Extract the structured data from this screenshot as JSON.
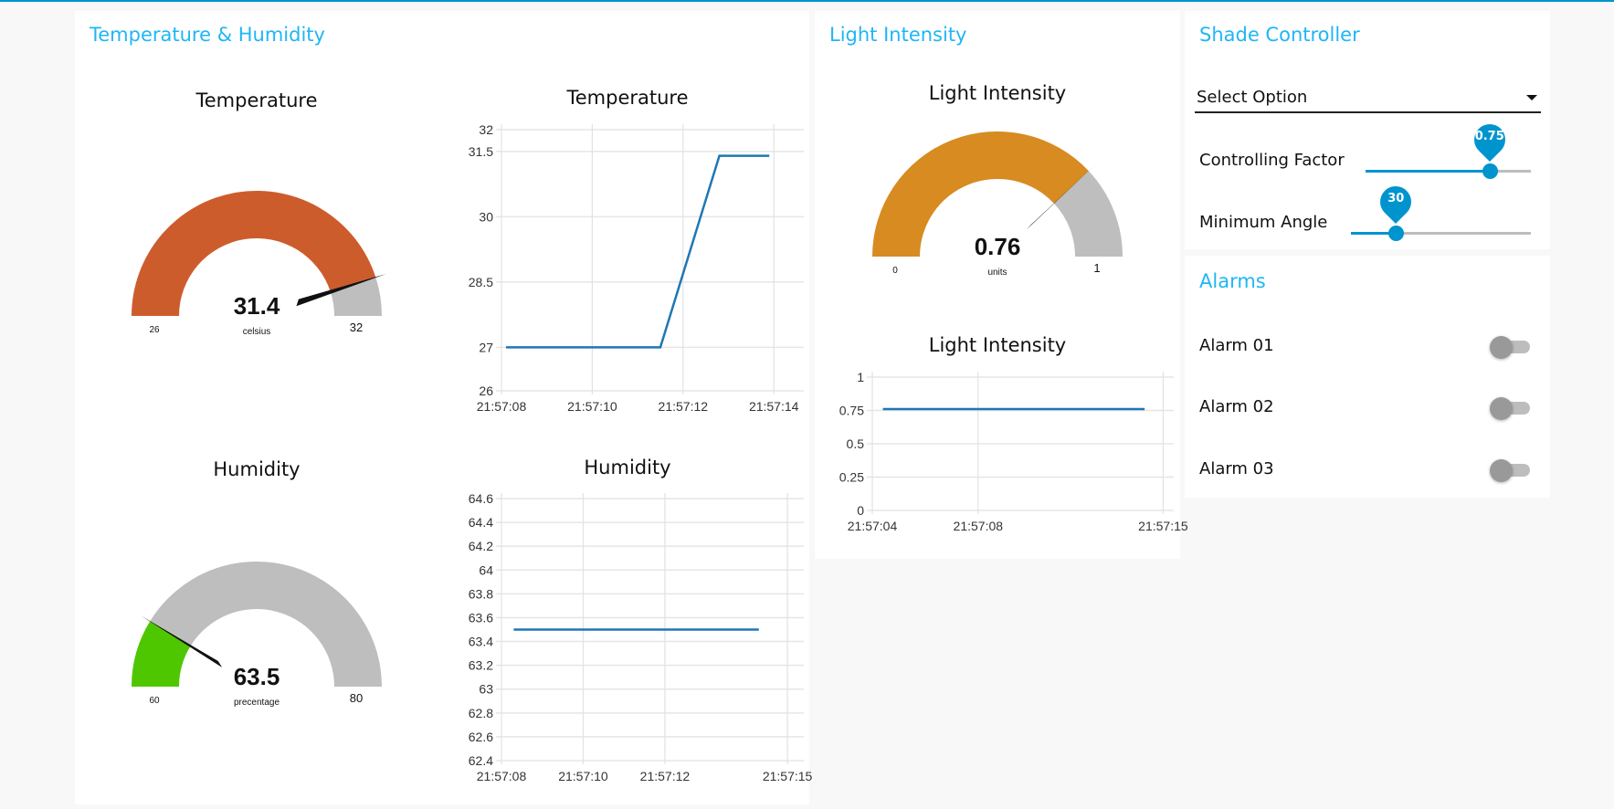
{
  "theme": {
    "accent": "#0094ce",
    "title_color": "#1fb6f5",
    "line_color": "#1f77b4"
  },
  "groups": {
    "temp_hum": {
      "title": "Temperature & Humidity"
    },
    "light": {
      "title": "Light Intensity"
    },
    "shade": {
      "title": "Shade Controller"
    },
    "alarms": {
      "title": "Alarms"
    }
  },
  "gauges": {
    "temperature": {
      "title": "Temperature",
      "value": 31.4,
      "value_text": "31.4",
      "units": "celsius",
      "min": 26,
      "max": 32,
      "min_text": "26",
      "max_text": "32",
      "color": "#cd5c2d"
    },
    "humidity": {
      "title": "Humidity",
      "value": 63.5,
      "value_text": "63.5",
      "units": "precentage",
      "min": 60,
      "max": 80,
      "min_text": "60",
      "max_text": "80",
      "color": "#4ec700"
    },
    "light": {
      "title": "Light Intensity",
      "value": 0.76,
      "value_text": "0.76",
      "units": "units",
      "min": 0,
      "max": 1,
      "min_text": "0",
      "max_text": "1",
      "color": "#d78b20"
    }
  },
  "chart_data": [
    {
      "id": "temperature",
      "type": "line",
      "title": "Temperature",
      "xlabel": "",
      "ylabel": "",
      "x_unit": "seconds after 21:57:00",
      "xlim": [
        8,
        14.66
      ],
      "ylim": [
        26,
        32
      ],
      "grid": true,
      "y_ticks": [
        26,
        27,
        28.5,
        30,
        31.5,
        32
      ],
      "y_tick_labels": [
        "26",
        "27",
        "28.5",
        "30",
        "31.5",
        "32"
      ],
      "x_ticks": [
        8,
        10,
        12,
        14
      ],
      "x_tick_labels": [
        "21:57:08",
        "21:57:10",
        "21:57:12",
        "21:57:14"
      ],
      "series": [
        {
          "name": "Temperature",
          "x": [
            8.1,
            11.5,
            12.8,
            13.9
          ],
          "y": [
            27,
            27,
            31.4,
            31.4
          ]
        }
      ]
    },
    {
      "id": "humidity",
      "type": "line",
      "title": "Humidity",
      "xlabel": "",
      "ylabel": "",
      "x_unit": "seconds after 21:57:00",
      "xlim": [
        8,
        15.4
      ],
      "ylim": [
        62.4,
        64.6
      ],
      "grid": true,
      "y_ticks": [
        62.4,
        62.6,
        62.8,
        63,
        63.2,
        63.4,
        63.6,
        63.8,
        64,
        64.2,
        64.4,
        64.6
      ],
      "y_tick_labels": [
        "62.4",
        "62.6",
        "62.8",
        "63",
        "63.2",
        "63.4",
        "63.6",
        "63.8",
        "64",
        "64.2",
        "64.4",
        "64.6"
      ],
      "x_ticks": [
        8,
        10,
        12,
        15
      ],
      "x_tick_labels": [
        "21:57:08",
        "21:57:10",
        "21:57:12",
        "21:57:15"
      ],
      "series": [
        {
          "name": "Humidity",
          "x": [
            8.3,
            14.3
          ],
          "y": [
            63.5,
            63.5
          ]
        }
      ]
    },
    {
      "id": "light",
      "type": "line",
      "title": "Light Intensity",
      "xlabel": "",
      "ylabel": "",
      "x_unit": "seconds after 21:57:00",
      "xlim": [
        4,
        15.4
      ],
      "ylim": [
        0,
        1
      ],
      "grid": true,
      "y_ticks": [
        0,
        0.25,
        0.5,
        0.75,
        1
      ],
      "y_tick_labels": [
        "0",
        "0.25",
        "0.5",
        "0.75",
        "1"
      ],
      "x_ticks": [
        4,
        8,
        15
      ],
      "x_tick_labels": [
        "21:57:04",
        "21:57:08",
        "21:57:15"
      ],
      "series": [
        {
          "name": "Light Intensity",
          "x": [
            4.4,
            14.3
          ],
          "y": [
            0.76,
            0.76
          ]
        }
      ]
    }
  ],
  "shade": {
    "select": {
      "value": "Select Option"
    },
    "sliders": [
      {
        "label": "Controlling Factor",
        "value": 0.75,
        "value_text": "0.75",
        "fraction": 0.75
      },
      {
        "label": "Minimum Angle",
        "value": 30,
        "value_text": "30",
        "fraction": 0.25
      }
    ]
  },
  "alarms": {
    "items": [
      {
        "label": "Alarm 01",
        "on": false
      },
      {
        "label": "Alarm 02",
        "on": false
      },
      {
        "label": "Alarm 03",
        "on": false
      }
    ]
  }
}
